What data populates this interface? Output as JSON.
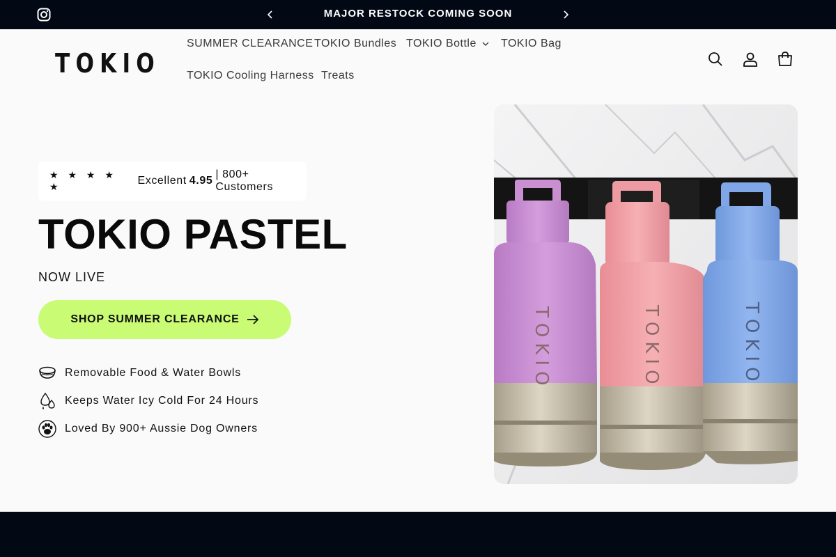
{
  "announcement": {
    "message": "MAJOR RESTOCK COMING SOON",
    "social_icon": "instagram-icon",
    "prev_icon": "chevron-left-icon",
    "next_icon": "chevron-right-icon"
  },
  "header": {
    "logo": "TOKIO",
    "nav": [
      {
        "label": "SUMMER CLEARANCE"
      },
      {
        "label": "TOKIO Bundles"
      },
      {
        "label": "TOKIO Bottle",
        "has_dropdown": true
      },
      {
        "label": "TOKIO Bag"
      },
      {
        "label": "TOKIO Cooling Harness"
      },
      {
        "label": "Treats"
      }
    ],
    "icons": [
      "search-icon",
      "account-icon",
      "cart-icon"
    ]
  },
  "hero": {
    "rating": {
      "stars": "★ ★ ★ ★ ★",
      "prefix": "Excellent",
      "score": "4.95",
      "suffix": "| 800+ Customers"
    },
    "title": "TOKIO PASTEL",
    "subtitle": "NOW LIVE",
    "cta_label": "SHOP SUMMER CLEARANCE",
    "features": [
      {
        "icon": "bowl-icon",
        "text": "Removable Food & Water Bowls"
      },
      {
        "icon": "water-drops-icon",
        "text": "Keeps Water Icy Cold For 24 Hours"
      },
      {
        "icon": "paw-icon",
        "text": "Loved By 900+ Aussie Dog Owners"
      }
    ],
    "bottle_text": "TOKIO",
    "colors": {
      "cta": "#c9fb74",
      "dark": "#020814",
      "bottle_lilac": "#c98fd0",
      "bottle_pink": "#f2a0a6",
      "bottle_blue": "#7fa6e6"
    }
  }
}
